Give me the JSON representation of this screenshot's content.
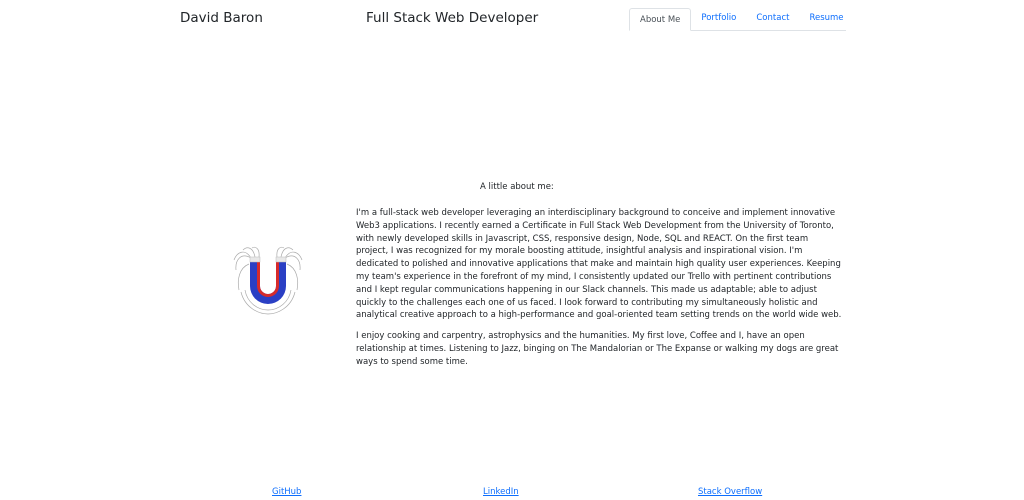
{
  "header": {
    "brand": "David Baron",
    "tagline": "Full Stack Web Developer"
  },
  "nav": {
    "tabs": [
      {
        "label": "About Me",
        "active": true
      },
      {
        "label": "Portfolio",
        "active": false
      },
      {
        "label": "Contact",
        "active": false
      },
      {
        "label": "Resume",
        "active": false
      }
    ]
  },
  "logo": {
    "icon": "magnet-icon",
    "colors": {
      "red": "#d62b2b",
      "blue": "#2a3fc4",
      "field": "#aaaaaa"
    }
  },
  "about": {
    "heading": "A little about me:",
    "paragraphs": [
      "I'm a full-stack web developer leveraging an interdisciplinary background to conceive and implement innovative Web3 applications. I recently earned a Certificate in Full Stack Web Development from the University of Toronto, with newly developed skills in Javascript, CSS, responsive design, Node, SQL and REACT. On the first team project, I was recognized for my morale boosting attitude, insightful analysis and inspirational vision. I'm dedicated to polished and innovative applications that make and maintain high quality user experiences. Keeping my team's experience in the forefront of my mind, I consistently updated our Trello with pertinent contributions and I kept regular communications happening in our Slack channels. This made us adaptable; able to adjust quickly to the challenges each one of us faced. I look forward to contributing my simultaneously holistic and analytical creative approach to a high-performance and goal-oriented team setting trends on the world wide web.",
      "I enjoy cooking and carpentry, astrophysics and the humanities. My first love, Coffee and I, have an open relationship at times. Listening to Jazz, binging on The Mandalorian or The Expanse or walking my dogs are great ways to spend some time."
    ]
  },
  "footer": {
    "links": [
      "GitHub",
      "LinkedIn",
      "Stack Overflow"
    ]
  },
  "colors": {
    "link": "#0d6efd",
    "text": "#212529",
    "tab_border": "#dee2e6"
  }
}
